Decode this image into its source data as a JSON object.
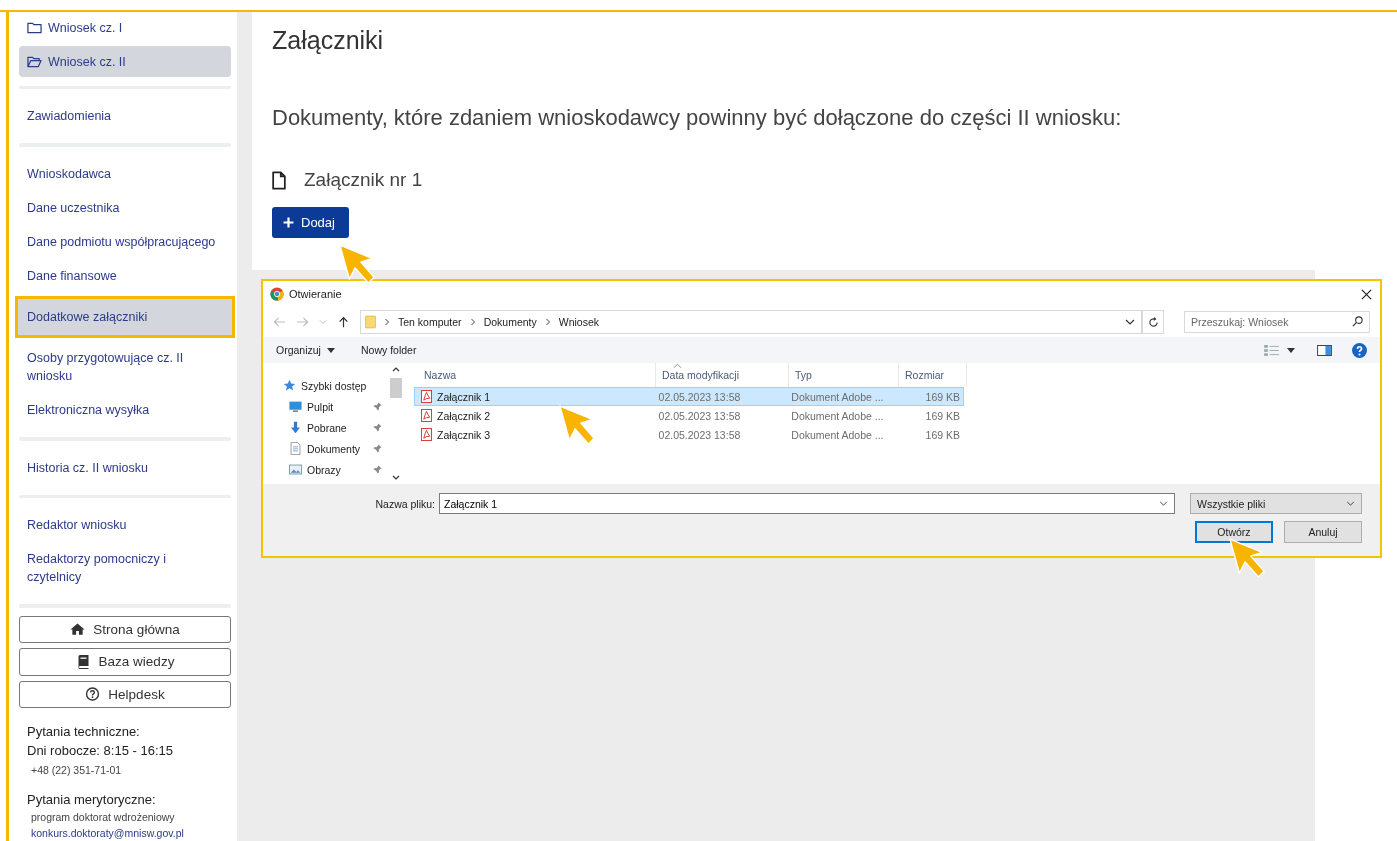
{
  "sidebar": {
    "folders": [
      {
        "label": "Wniosek cz. I",
        "expanded": false,
        "selected": false
      },
      {
        "label": "Wniosek cz. II",
        "expanded": true,
        "selected": true
      }
    ],
    "groups": [
      [
        {
          "label": "Zawiadomienia",
          "highlighted": false
        }
      ],
      [
        {
          "label": "Wnioskodawca",
          "highlighted": false
        },
        {
          "label": "Dane uczestnika",
          "highlighted": false
        },
        {
          "label": "Dane podmiotu współpracującego",
          "highlighted": false
        },
        {
          "label": "Dane finansowe",
          "highlighted": false
        },
        {
          "label": "Dodatkowe załączniki",
          "highlighted": true
        },
        {
          "label": "Osoby przygotowujące cz. II wniosku",
          "highlighted": false
        },
        {
          "label": "Elektroniczna wysyłka",
          "highlighted": false
        }
      ],
      [
        {
          "label": "Historia cz. II wniosku",
          "highlighted": false
        }
      ],
      [
        {
          "label": "Redaktor wniosku",
          "highlighted": false
        },
        {
          "label": "Redaktorzy pomocniczy i czytelnicy",
          "highlighted": false
        }
      ]
    ],
    "buttons": [
      {
        "label": "Strona główna",
        "kind": "home"
      },
      {
        "label": "Baza wiedzy",
        "kind": "book"
      },
      {
        "label": "Helpdesk",
        "kind": "help"
      }
    ],
    "contact": {
      "tech_heading": "Pytania techniczne:",
      "tech_hours": "Dni robocze: 8:15 - 16:15",
      "tech_phone": "+48 (22) 351-71-01",
      "subject_heading": "Pytania merytoryczne:",
      "subject_program": "program doktorat wdrożeniowy",
      "subject_email": "konkurs.doktoraty@mnisw.gov.pl"
    }
  },
  "main": {
    "title": "Załączniki",
    "description": "Dokumenty, które zdaniem wnioskodawcy powinny być dołączone do części II wniosku:",
    "attachment": "Załącznik nr 1",
    "add_button": "Dodaj"
  },
  "dialog": {
    "title": "Otwieranie",
    "path": [
      "Ten komputer",
      "Dokumenty",
      "Wniosek"
    ],
    "search": {
      "placeholder": "Przeszukaj: Wniosek"
    },
    "toolbar": {
      "organize": "Organizuj",
      "new_folder": "Nowy folder"
    },
    "nav": [
      {
        "label": "Szybki dostęp",
        "kind": "star",
        "pinned": false
      },
      {
        "label": "Pulpit",
        "kind": "desktop",
        "pinned": true
      },
      {
        "label": "Pobrane",
        "kind": "download",
        "pinned": true
      },
      {
        "label": "Dokumenty",
        "kind": "documents",
        "pinned": true
      },
      {
        "label": "Obrazy",
        "kind": "pictures",
        "pinned": true
      }
    ],
    "columns": [
      "Nazwa",
      "Data modyfikacji",
      "Typ",
      "Rozmiar"
    ],
    "files": [
      {
        "name": "Załącznik 1",
        "date": "02.05.2023 13:58",
        "type": "Dokument Adobe ...",
        "size": "169 KB",
        "selected": true
      },
      {
        "name": "Załącznik 2",
        "date": "02.05.2023 13:58",
        "type": "Dokument Adobe ...",
        "size": "169 KB",
        "selected": false
      },
      {
        "name": "Załącznik 3",
        "date": "02.05.2023 13:58",
        "type": "Dokument Adobe ...",
        "size": "169 KB",
        "selected": false
      }
    ],
    "filename_label": "Nazwa pliku:",
    "filename": "Załącznik 1",
    "filter": "Wszystkie pliki",
    "buttons": [
      {
        "label": "Otwórz",
        "kind": "primary"
      },
      {
        "label": "Anuluj",
        "kind": "secondary"
      }
    ]
  }
}
